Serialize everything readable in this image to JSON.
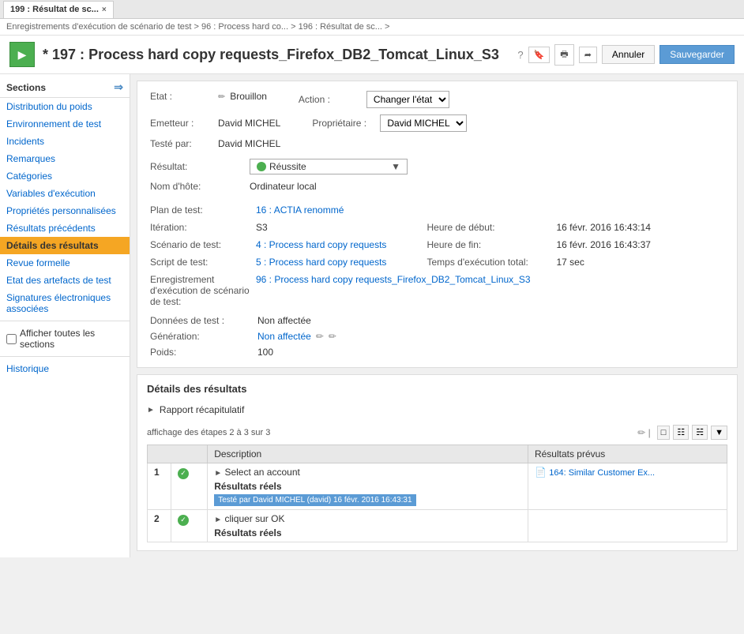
{
  "tab": {
    "label": "199 : Résultat de sc...",
    "close": "×"
  },
  "breadcrumb": {
    "text": "Enregistrements d'exécution de scénario de test > 96 : Process hard co... > 196 : Résultat de sc... >"
  },
  "header": {
    "id": "197 :",
    "title": "Process hard copy requests_Firefox_DB2_Tomcat_Linux_S3",
    "asterisk": "*",
    "cancel_label": "Annuler",
    "save_label": "Sauvegarder"
  },
  "sidebar": {
    "title": "Sections",
    "items": [
      {
        "label": "Distribution du poids"
      },
      {
        "label": "Environnement de test"
      },
      {
        "label": "Incidents"
      },
      {
        "label": "Remarques"
      },
      {
        "label": "Catégories"
      },
      {
        "label": "Variables d'exécution"
      },
      {
        "label": "Propriétés personnalisées"
      },
      {
        "label": "Résultats précédents"
      },
      {
        "label": "Détails des résultats",
        "active": true
      },
      {
        "label": "Revue formelle"
      },
      {
        "label": "Etat des artefacts de test"
      },
      {
        "label": "Signatures électroniques associées"
      }
    ],
    "checkbox_label": "Afficher toutes les sections",
    "historique": "Historique"
  },
  "form": {
    "etat_label": "Etat :",
    "etat_value": "Brouillon",
    "action_label": "Action :",
    "action_value": "Changer l'état",
    "emetteur_label": "Emetteur :",
    "emetteur_value": "David MICHEL",
    "proprietaire_label": "Propriétaire :",
    "proprietaire_value": "David MICHEL",
    "teste_par_label": "Testé par:",
    "teste_par_value": "David MICHEL",
    "resultat_label": "Résultat:",
    "resultat_value": "Réussite",
    "nom_hote_label": "Nom d'hôte:",
    "nom_hote_value": "Ordinateur local",
    "plan_test_label": "Plan de test:",
    "plan_test_value": "16 : ACTIA renommé",
    "iteration_label": "Itération:",
    "iteration_value": "S3",
    "heure_debut_label": "Heure de début:",
    "heure_debut_value": "16 févr. 2016 16:43:14",
    "scenario_label": "Scénario de test:",
    "scenario_value": "4 : Process hard copy requests",
    "heure_fin_label": "Heure de fin:",
    "heure_fin_value": "16 févr. 2016 16:43:37",
    "script_label": "Script de test:",
    "script_value": "5 : Process hard copy requests",
    "temps_exec_label": "Temps d'exécution total:",
    "temps_exec_value": "17 sec",
    "enregistrement_label": "Enregistrement d'exécution de scénario de test:",
    "enregistrement_value": "96 : Process hard copy requests_Firefox_DB2_Tomcat_Linux_S3",
    "donnees_label": "Données de test :",
    "donnees_value": "Non affectée",
    "generation_label": "Génération:",
    "generation_value": "Non affectée",
    "poids_label": "Poids:",
    "poids_value": "100"
  },
  "results_section": {
    "title": "Détails des résultats",
    "rapport_label": "Rapport récapitulatif",
    "steps_info": "affichage des étapes 2 à 3 sur 3",
    "table": {
      "col1": "Description",
      "col2": "Résultats prévus",
      "rows": [
        {
          "num": "1",
          "check": "✓",
          "description": "Select an account",
          "subdescription": "Résultats réels",
          "tested_badge": "Testé par",
          "tested_value": "David MICHEL (david) 16 févr. 2016 16:43:31",
          "doc_link": "164: Similar Customer Ex..."
        },
        {
          "num": "2",
          "check": "✓",
          "description": "cliquer sur OK",
          "subdescription": "Résultats réels"
        }
      ]
    }
  }
}
